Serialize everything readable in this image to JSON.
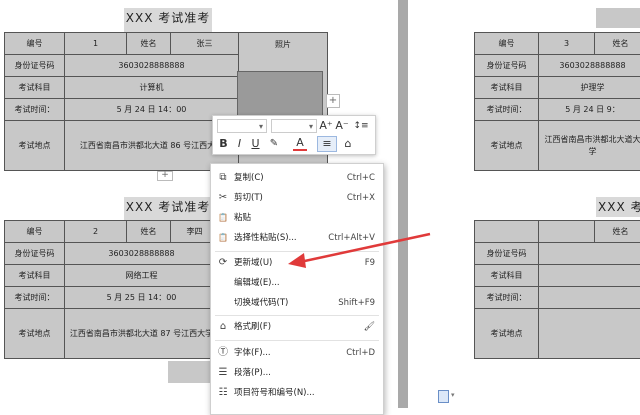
{
  "left_page": {
    "card1": {
      "title": "XXX 考试准考证",
      "number_label": "编号",
      "number_value": "1",
      "name_label": "姓名",
      "name_value": "张三",
      "photo_label": "照片",
      "id_label": "身份证号码",
      "id_value": "3603028888888",
      "subject_label": "考试科目",
      "subject_value": "计算机",
      "time_label": "考试时间：",
      "time_value": "5 月 24 日 14：00",
      "place_label": "考试地点",
      "place_value": "江西省南昌市洪都北大道 86 号江西大学"
    },
    "card2": {
      "title": "XXX 考试准考证",
      "number_label": "编号",
      "number_value": "2",
      "name_label": "姓名",
      "name_value": "李四",
      "id_label": "身份证号码",
      "id_value": "3603028888888",
      "subject_label": "考试科目",
      "subject_value": "网络工程",
      "time_label": "考试时间：",
      "time_value": "5 月 25 日 14：00",
      "place_label": "考试地点",
      "place_value": "江西省南昌市洪都北大道 87 号江西大学"
    }
  },
  "right_page": {
    "card1": {
      "number_label": "编号",
      "number_value": "3",
      "name_label": "姓名",
      "id_label": "身份证号码",
      "id_value": "3603028888888",
      "subject_label": "考试科目",
      "subject_value": "护理学",
      "time_label": "考试时间：",
      "time_value": "5 月 24 日 9：",
      "place_label": "考试地点",
      "place_value": "江西省南昌市洪都北大道大学"
    },
    "card2": {
      "title": "XXX 考试",
      "name_label": "姓名",
      "id_label": "身份证号码",
      "subject_label": "考试科目",
      "time_label": "考试时间：",
      "place_label": "考试地点"
    }
  },
  "mini_toolbar": {
    "font_size_text": "▾",
    "grow_font": "A⁺",
    "shrink_font": "A⁻",
    "line_spacing": "↕≡",
    "bold": "B",
    "italic": "I",
    "underline": "U",
    "font_color": "A",
    "highlight": "✎",
    "align": "≡",
    "format_painter": "⌂"
  },
  "context_menu": {
    "items": [
      {
        "icon": "copy-icon",
        "glyph": "⧉",
        "label": "复制(C)",
        "shortcut": "Ctrl+C"
      },
      {
        "icon": "cut-icon",
        "glyph": "✂",
        "label": "剪切(T)",
        "shortcut": "Ctrl+X"
      },
      {
        "icon": "paste-icon",
        "glyph": "📋",
        "label": "粘贴",
        "shortcut": ""
      },
      {
        "icon": "paste-special-icon",
        "glyph": "📋",
        "label": "选择性粘贴(S)...",
        "shortcut": "Ctrl+Alt+V"
      },
      {
        "icon": "update-field-icon",
        "glyph": "⟳",
        "label": "更新域(U)",
        "shortcut": "F9"
      },
      {
        "icon": "",
        "glyph": "",
        "label": "编辑域(E)...",
        "shortcut": ""
      },
      {
        "icon": "",
        "glyph": "",
        "label": "切换域代码(T)",
        "shortcut": "Shift+F9"
      },
      {
        "icon": "format-brush-icon",
        "glyph": "⌂",
        "label": "格式刷(F)",
        "shortcut": ""
      },
      {
        "icon": "font-icon",
        "glyph": "Ⓣ",
        "label": "字体(F)...",
        "shortcut": "Ctrl+D"
      },
      {
        "icon": "paragraph-icon",
        "glyph": "☰",
        "label": "段落(P)...",
        "shortcut": ""
      },
      {
        "icon": "bullets-icon",
        "glyph": "☷",
        "label": "项目符号和编号(N)...",
        "shortcut": ""
      }
    ]
  },
  "colors": {
    "cell_bg": "#c8c8c8",
    "gutter": "#a9a9a9",
    "arrow": "#e03a3a"
  }
}
